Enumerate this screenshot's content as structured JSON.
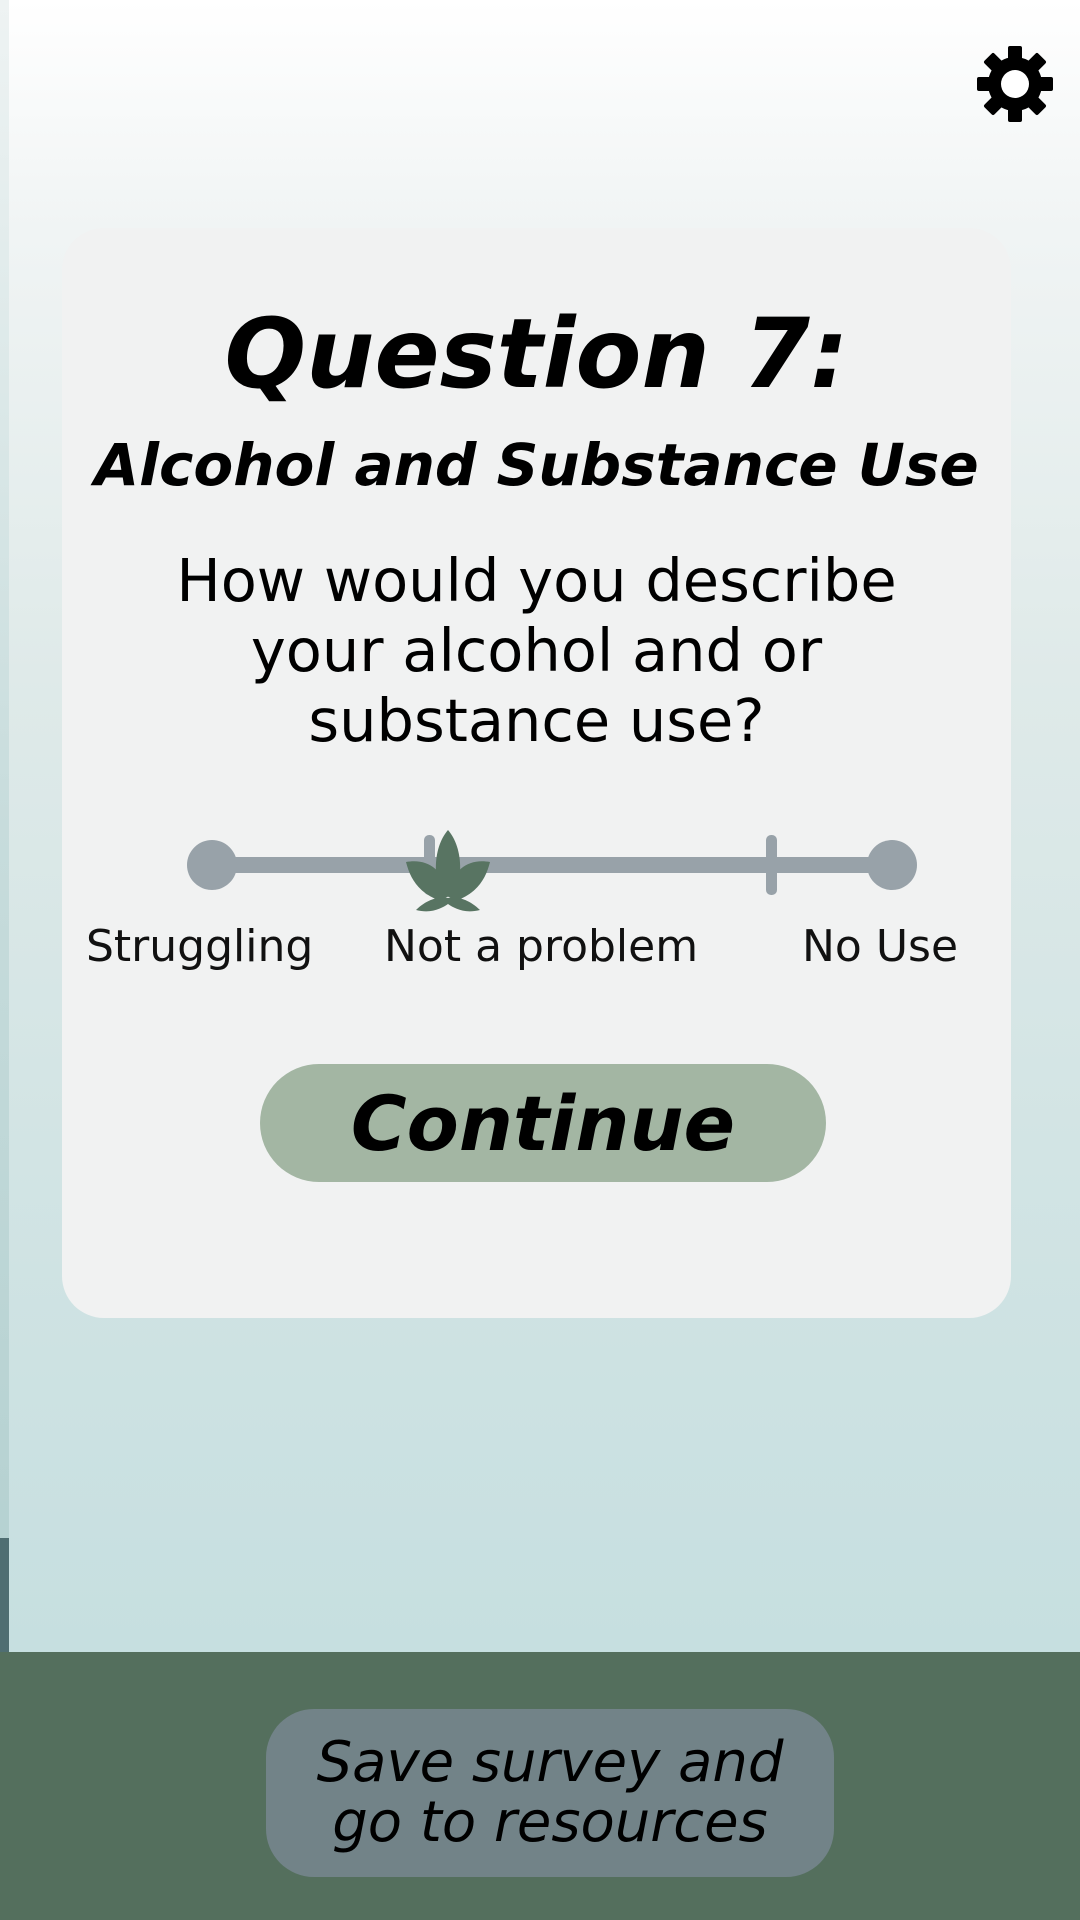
{
  "settings": {
    "icon": "gear-icon"
  },
  "question": {
    "title": "Question 7:",
    "category": "Alcohol and Substance Use",
    "prompt": "How would you describe your alcohol and or substance use?"
  },
  "slider": {
    "labels": [
      "Struggling",
      "Not a problem",
      "No Use"
    ],
    "stops": 5,
    "selected_index": 2,
    "thumb_icon": "leaf-icon"
  },
  "actions": {
    "continue_label": "Continue",
    "save_label_line1": "Save survey and",
    "save_label_line2": "go to resources"
  },
  "colors": {
    "card": "#f1f2f2",
    "track": "#98a2a9",
    "thumb": "#587462",
    "continue_button": "#a3b6a3",
    "footer": "#546f5d",
    "save_button": "#728388"
  }
}
